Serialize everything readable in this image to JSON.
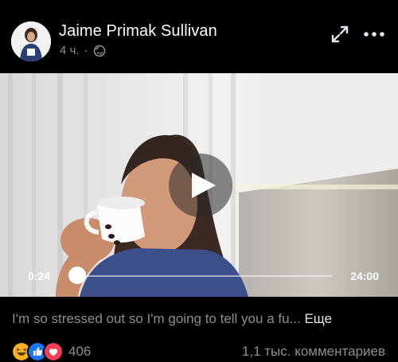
{
  "post": {
    "author": "Jaime Primak Sullivan",
    "time": "4 ч.",
    "separator": "·",
    "privacy_icon": "globe-icon"
  },
  "header": {
    "expand_icon": "expand-icon",
    "more_icon": "more-icon"
  },
  "video": {
    "current_time": "0:24",
    "total_time": "24:00",
    "progress_fraction": 0.0167
  },
  "caption": {
    "text": "I'm so stressed out so I'm going to tell you a fu...",
    "see_more": "Еще"
  },
  "footer": {
    "reactions": [
      "haha",
      "like",
      "love"
    ],
    "reaction_count": "406",
    "comments": "1,1 тыс. комментариев"
  },
  "colors": {
    "background": "#000000",
    "secondary_text": "#8a8d91",
    "like_blue": "#1877f2",
    "love_red": "#f33e58",
    "haha_yellow": "#f7b125"
  }
}
